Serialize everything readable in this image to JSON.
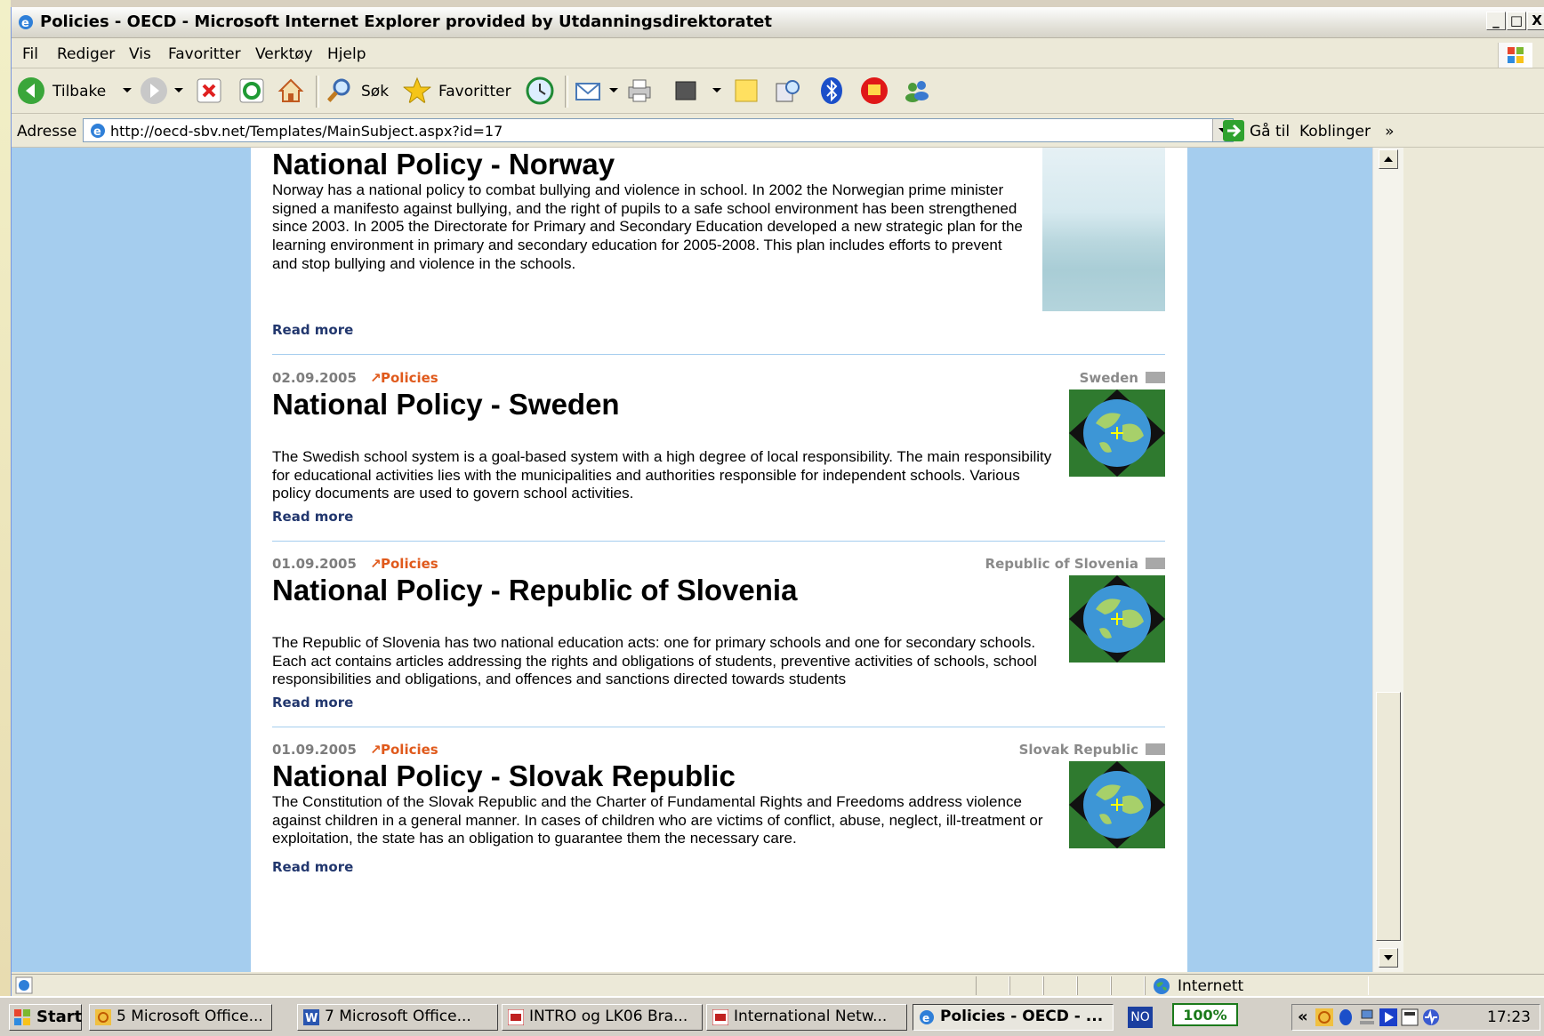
{
  "window": {
    "title": "Policies - OECD - Microsoft Internet Explorer provided by Utdanningsdirektoratet",
    "min_label": "_",
    "max_label": "□",
    "close_label": "X"
  },
  "menu": [
    "Fil",
    "Rediger",
    "Vis",
    "Favoritter",
    "Verktøy",
    "Hjelp"
  ],
  "toolbar": {
    "back_label": "Tilbake",
    "search_label": "Søk",
    "favorites_label": "Favoritter"
  },
  "address": {
    "label": "Adresse",
    "url": "http://oecd-sbv.net/Templates/MainSubject.aspx?id=17",
    "go_label": "Gå til",
    "links_label": "Koblinger",
    "links_more": "»"
  },
  "articles": [
    {
      "title": "National Policy - Norway",
      "body": "Norway has a national policy to combat bullying and violence in school. In 2002 the Norwegian prime minister signed a manifesto against bullying, and the right of pupils to a safe school environment has been strengthened since 2003. In 2005 the Directorate for Primary and Secondary Education developed a new strategic plan for the learning environment in primary and secondary education for 2005-2008. This plan includes efforts to prevent and stop bullying and violence in the schools.",
      "read_more": "Read more"
    },
    {
      "date": "02.09.2005",
      "category": "Policies",
      "country": "Sweden",
      "title": "National Policy - Sweden",
      "body": "The Swedish school system is a goal-based system with a high degree of local responsibility. The main responsibility for educational activities lies with the municipalities and authorities responsible for independent schools. Various policy documents are used to govern school activities.",
      "read_more": "Read more"
    },
    {
      "date": "01.09.2005",
      "category": "Policies",
      "country": "Republic of Slovenia",
      "title": "National Policy - Republic of Slovenia",
      "body": "The Republic of Slovenia has two national education acts: one for primary schools and one for secondary schools. Each act contains articles addressing the rights and obligations of students, preventive activities of schools, school responsibilities and obligations, and offences and sanctions directed towards students",
      "read_more": "Read more"
    },
    {
      "date": "01.09.2005",
      "category": "Policies",
      "country": "Slovak Republic",
      "title": "National Policy - Slovak Republic",
      "body": "The Constitution of the Slovak Republic and the Charter of Fundamental Rights and Freedoms address violence against children in a general manner. In cases of children who are victims of conflict, abuse, neglect, ill-treatment or exploitation, the state has an obligation to guarantee them the necessary care.",
      "read_more": "Read more"
    }
  ],
  "status": {
    "zone": "Internett"
  },
  "taskbar": {
    "start_label": "Start",
    "tasks": [
      "5 Microsoft Office...",
      "7 Microsoft Office...",
      "INTRO og LK06 Bra...",
      "International Netw...",
      "Policies - OECD - ..."
    ],
    "lang": "NO",
    "zoom": "100%",
    "tray_more": "«",
    "clock": "17:23"
  },
  "colors": {
    "page_bg": "#a5cdee",
    "category": "#e05a1c",
    "read_more": "#22376e",
    "meta": "#7d7d7d"
  },
  "icons": [
    "ie-icon",
    "windows-flag-icon",
    "back-icon",
    "forward-icon",
    "stop-icon",
    "refresh-icon",
    "home-icon",
    "search-icon",
    "favorites-star-icon",
    "history-icon",
    "mail-icon",
    "print-icon",
    "edit-icon",
    "notes-icon",
    "research-icon",
    "bluetooth-icon",
    "messenger-icon",
    "contacts-icon",
    "globe-icon",
    "flag-icon"
  ]
}
